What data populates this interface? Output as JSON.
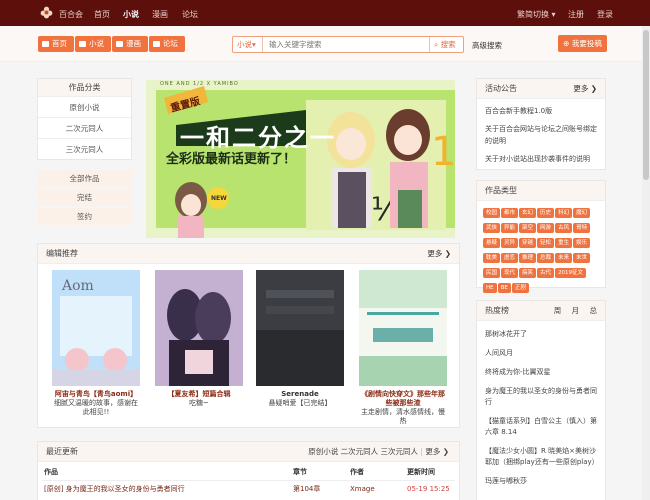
{
  "topnav": {
    "site": "百合会",
    "items": [
      "首页",
      "小说",
      "漫画",
      "论坛"
    ],
    "active": "小说",
    "right": [
      "繁简切换 ▾",
      "注册",
      "登录"
    ]
  },
  "quicknav": [
    "首页",
    "小说",
    "漫画",
    "论坛"
  ],
  "search": {
    "scope": "小说▾",
    "placeholder": "输入关键字搜索",
    "button": "搜索",
    "advanced": "高级搜索"
  },
  "post_button": "我要投稿",
  "categories": {
    "title": "作品分类",
    "items": [
      "原创小说",
      "二次元同人",
      "三次元同人"
    ],
    "filters": [
      "全部作品",
      "完结",
      "签约"
    ]
  },
  "banner": {
    "badge": "重置版",
    "title": "一和二分之一",
    "subtitle": "全彩版最新话更新了！",
    "strip": "ONE AND 1/2 X YAMIBO",
    "new": "NEW"
  },
  "editor_picks": {
    "title": "编辑推荐",
    "more": "更多",
    "books": [
      {
        "title": "阿宙与青鸟【青鸟aomi】",
        "desc": "细腻又温暖的故事，感谢在此相见!!"
      },
      {
        "title": "【夏友希】短篇合辑",
        "desc": "吃糖~"
      },
      {
        "title": "Serenade",
        "desc": "悬疑哨爱【已完结】"
      },
      {
        "title": "《剧情向快穿文》那些年那些被那些渣",
        "desc": "主走剧情，清水感情线，慢热"
      }
    ]
  },
  "recent": {
    "title": "最近更新",
    "links": [
      "原创小说",
      "二次元同人",
      "三次元同人"
    ],
    "more": "更多",
    "headers": [
      "作品",
      "章节",
      "作者",
      "更新时间"
    ],
    "rows": [
      {
        "work": "[原创] 身为魔王的我以圣女的身份与勇者同行",
        "chapter": "第104章",
        "author": "Xmage",
        "time": "05-19 15:25"
      }
    ]
  },
  "announcements": {
    "title": "活动公告",
    "more": "更多",
    "items": [
      "百合会新手教程1.0版",
      "关于百合会网站与论坛之间账号绑定的说明",
      "关于对小说站出现抄袭事件的说明"
    ]
  },
  "genres": {
    "title": "作品类型",
    "tags": [
      "校园",
      "都市",
      "玄幻",
      "历史",
      "科幻",
      "魔幻",
      "武侠",
      "异能",
      "架空",
      "网游",
      "古风",
      "哥特",
      "悬疑",
      "灵异",
      "穿越",
      "轻松",
      "重生",
      "娱乐",
      "耽美",
      "虐恋",
      "推理",
      "总裁",
      "未来",
      "末世",
      "民国",
      "现代",
      "搞笑",
      "古代",
      "2019征文",
      "HE",
      "BE",
      "正剧"
    ]
  },
  "hot": {
    "title": "热度榜",
    "tabs": [
      "周",
      "月",
      "总"
    ],
    "items": [
      "那树冰花开了",
      "人间风月",
      "终将成为你-比翼双星",
      "身为魔王的我以圣女的身份与勇者同行",
      "【猫童话系列】白雪公主（慎入）第六章 8.14",
      "【魔法少女小圆】R 晓美焰×美树沙耶加（捆绑play还有一些原创play）",
      "玛莲与嘟秋莎"
    ]
  },
  "colors": {
    "topbar": "#5d0f0b",
    "accent": "#f0733f",
    "panel_head": "#fbf5f1"
  }
}
